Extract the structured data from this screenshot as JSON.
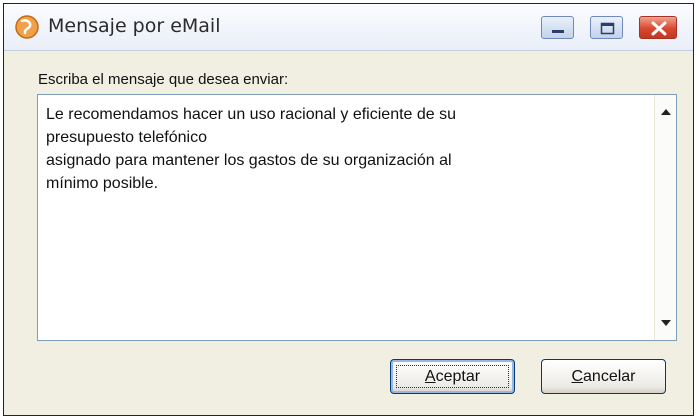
{
  "window": {
    "title": "Mensaje por eMail",
    "icon": "phone-app-icon"
  },
  "titlebar_buttons": {
    "minimize": "minimize-icon",
    "maximize": "maximize-icon",
    "close": "close-icon"
  },
  "dialog": {
    "prompt": "Escriba el mensaje que desea enviar:",
    "message_lines": [
      "Le recomendamos hacer un uso racional y eficiente de su",
      "presupuesto telefónico",
      "asignado para mantener los gastos de su organización al",
      "mínimo posible."
    ]
  },
  "buttons": {
    "accept_mnemonic": "A",
    "accept_rest": "ceptar",
    "cancel_mnemonic": "C",
    "cancel_rest": "ancelar"
  },
  "colors": {
    "window_border": "#0a246a",
    "close_button": "#d9482f",
    "dialog_background": "#f1efe2"
  }
}
